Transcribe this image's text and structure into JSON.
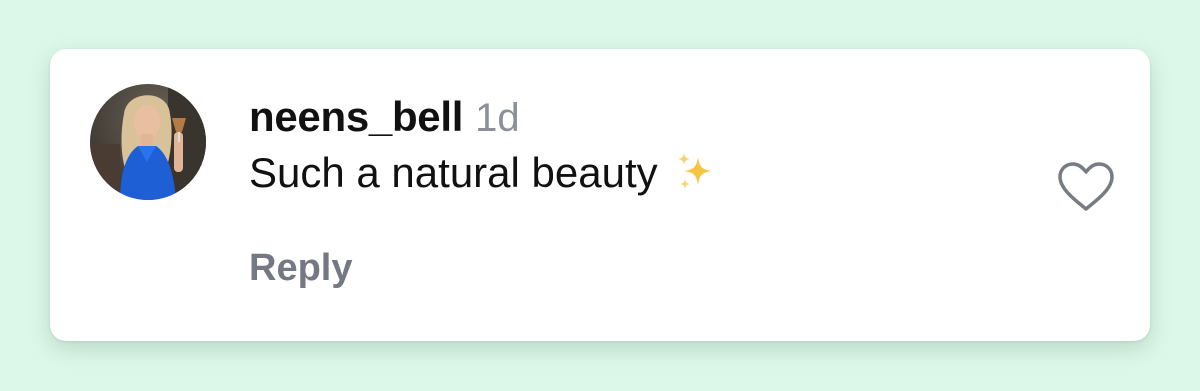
{
  "comment": {
    "username": "neens_bell",
    "timestamp": "1d",
    "text": "Such a natural beauty",
    "reply_label": "Reply"
  },
  "icons": {
    "avatar": "user-profile-photo",
    "sparkles": "sparkles-emoji",
    "like": "heart-outline-icon"
  },
  "colors": {
    "page_background": "#dcf8e8",
    "card_background": "#ffffff",
    "username": "#111111",
    "timestamp": "#8a8f98",
    "reply": "#737882",
    "sparkles": "#f5c542"
  }
}
